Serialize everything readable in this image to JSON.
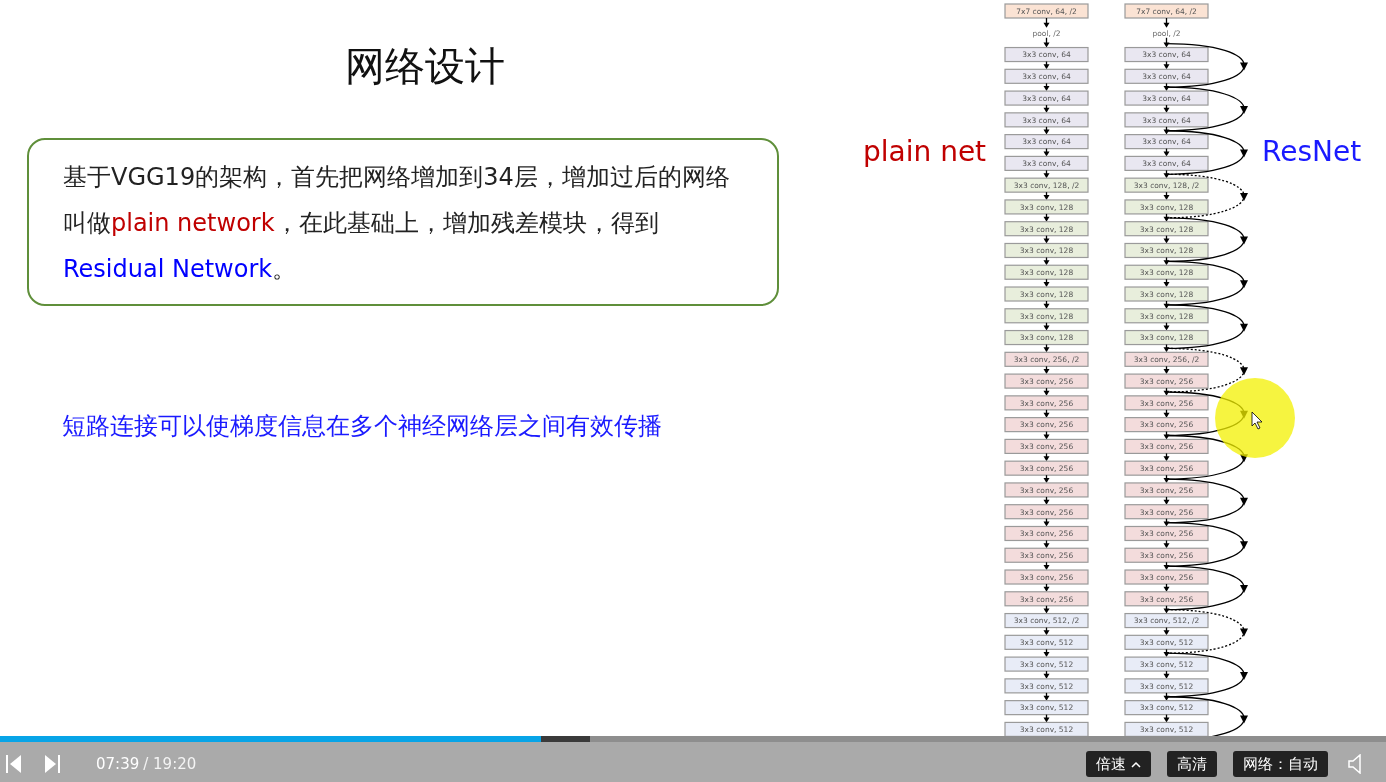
{
  "slide": {
    "title": "网络设计",
    "note_box": [
      {
        "text": "基于VGG19的架构，首先把网络增加到34层，增加过后的网络叫做"
      },
      {
        "text": "plain network",
        "color": "#c00000"
      },
      {
        "text": "，在此基础上，增加残差模块，得到"
      },
      {
        "text": "Residual Network",
        "color": "#0000ff"
      },
      {
        "text": "。"
      }
    ],
    "highlight": "短路连接可以使梯度信息在多个神经网络层之间有效传播",
    "diagram": {
      "plain_label": "plain net",
      "resnet_label": "ResNet",
      "plain": [
        {
          "label": "7x7 conv, 64, /2",
          "kind": "box",
          "color": "#fbe3d4"
        },
        {
          "label": "pool, /2",
          "kind": "text"
        },
        {
          "label": "3x3 conv, 64",
          "kind": "box",
          "color": "#e9e7f1"
        },
        {
          "label": "3x3 conv, 64",
          "kind": "box",
          "color": "#e9e7f1"
        },
        {
          "label": "3x3 conv, 64",
          "kind": "box",
          "color": "#e9e7f1"
        },
        {
          "label": "3x3 conv, 64",
          "kind": "box",
          "color": "#e9e7f1"
        },
        {
          "label": "3x3 conv, 64",
          "kind": "box",
          "color": "#e9e7f1"
        },
        {
          "label": "3x3 conv, 64",
          "kind": "box",
          "color": "#e9e7f1"
        },
        {
          "label": "3x3 conv, 128, /2",
          "kind": "box",
          "color": "#e8eedc"
        },
        {
          "label": "3x3 conv, 128",
          "kind": "box",
          "color": "#e8eedc"
        },
        {
          "label": "3x3 conv, 128",
          "kind": "box",
          "color": "#e8eedc"
        },
        {
          "label": "3x3 conv, 128",
          "kind": "box",
          "color": "#e8eedc"
        },
        {
          "label": "3x3 conv, 128",
          "kind": "box",
          "color": "#e8eedc"
        },
        {
          "label": "3x3 conv, 128",
          "kind": "box",
          "color": "#e8eedc"
        },
        {
          "label": "3x3 conv, 128",
          "kind": "box",
          "color": "#e8eedc"
        },
        {
          "label": "3x3 conv, 128",
          "kind": "box",
          "color": "#e8eedc"
        },
        {
          "label": "3x3 conv, 256, /2",
          "kind": "box",
          "color": "#f3dcdc"
        },
        {
          "label": "3x3 conv, 256",
          "kind": "box",
          "color": "#f3dcdc"
        },
        {
          "label": "3x3 conv, 256",
          "kind": "box",
          "color": "#f3dcdc"
        },
        {
          "label": "3x3 conv, 256",
          "kind": "box",
          "color": "#f3dcdc"
        },
        {
          "label": "3x3 conv, 256",
          "kind": "box",
          "color": "#f3dcdc"
        },
        {
          "label": "3x3 conv, 256",
          "kind": "box",
          "color": "#f3dcdc"
        },
        {
          "label": "3x3 conv, 256",
          "kind": "box",
          "color": "#f3dcdc"
        },
        {
          "label": "3x3 conv, 256",
          "kind": "box",
          "color": "#f3dcdc"
        },
        {
          "label": "3x3 conv, 256",
          "kind": "box",
          "color": "#f3dcdc"
        },
        {
          "label": "3x3 conv, 256",
          "kind": "box",
          "color": "#f3dcdc"
        },
        {
          "label": "3x3 conv, 256",
          "kind": "box",
          "color": "#f3dcdc"
        },
        {
          "label": "3x3 conv, 256",
          "kind": "box",
          "color": "#f3dcdc"
        },
        {
          "label": "3x3 conv, 512, /2",
          "kind": "box",
          "color": "#e8ecf7"
        },
        {
          "label": "3x3 conv, 512",
          "kind": "box",
          "color": "#e8ecf7"
        },
        {
          "label": "3x3 conv, 512",
          "kind": "box",
          "color": "#e8ecf7"
        },
        {
          "label": "3x3 conv, 512",
          "kind": "box",
          "color": "#e8ecf7"
        },
        {
          "label": "3x3 conv, 512",
          "kind": "box",
          "color": "#e8ecf7"
        },
        {
          "label": "3x3 conv, 512",
          "kind": "box",
          "color": "#e8ecf7"
        }
      ],
      "resnet": [
        {
          "label": "7x7 conv, 64, /2",
          "kind": "box",
          "color": "#fbe3d4"
        },
        {
          "label": "pool, /2",
          "kind": "text",
          "shortcut": {
            "dashed": false
          }
        },
        {
          "label": "3x3 conv, 64",
          "kind": "box",
          "color": "#e9e7f1"
        },
        {
          "label": "3x3 conv, 64",
          "kind": "box",
          "color": "#e9e7f1",
          "shortcut": {
            "dashed": false
          }
        },
        {
          "label": "3x3 conv, 64",
          "kind": "box",
          "color": "#e9e7f1"
        },
        {
          "label": "3x3 conv, 64",
          "kind": "box",
          "color": "#e9e7f1",
          "shortcut": {
            "dashed": false
          }
        },
        {
          "label": "3x3 conv, 64",
          "kind": "box",
          "color": "#e9e7f1"
        },
        {
          "label": "3x3 conv, 64",
          "kind": "box",
          "color": "#e9e7f1",
          "shortcut": {
            "dashed": true
          }
        },
        {
          "label": "3x3 conv, 128, /2",
          "kind": "box",
          "color": "#e8eedc"
        },
        {
          "label": "3x3 conv, 128",
          "kind": "box",
          "color": "#e8eedc",
          "shortcut": {
            "dashed": false
          }
        },
        {
          "label": "3x3 conv, 128",
          "kind": "box",
          "color": "#e8eedc"
        },
        {
          "label": "3x3 conv, 128",
          "kind": "box",
          "color": "#e8eedc",
          "shortcut": {
            "dashed": false
          }
        },
        {
          "label": "3x3 conv, 128",
          "kind": "box",
          "color": "#e8eedc"
        },
        {
          "label": "3x3 conv, 128",
          "kind": "box",
          "color": "#e8eedc",
          "shortcut": {
            "dashed": false
          }
        },
        {
          "label": "3x3 conv, 128",
          "kind": "box",
          "color": "#e8eedc"
        },
        {
          "label": "3x3 conv, 128",
          "kind": "box",
          "color": "#e8eedc",
          "shortcut": {
            "dashed": true
          }
        },
        {
          "label": "3x3 conv, 256, /2",
          "kind": "box",
          "color": "#f3dcdc"
        },
        {
          "label": "3x3 conv, 256",
          "kind": "box",
          "color": "#f3dcdc",
          "shortcut": {
            "dashed": false
          }
        },
        {
          "label": "3x3 conv, 256",
          "kind": "box",
          "color": "#f3dcdc"
        },
        {
          "label": "3x3 conv, 256",
          "kind": "box",
          "color": "#f3dcdc",
          "shortcut": {
            "dashed": false
          }
        },
        {
          "label": "3x3 conv, 256",
          "kind": "box",
          "color": "#f3dcdc"
        },
        {
          "label": "3x3 conv, 256",
          "kind": "box",
          "color": "#f3dcdc",
          "shortcut": {
            "dashed": false
          }
        },
        {
          "label": "3x3 conv, 256",
          "kind": "box",
          "color": "#f3dcdc"
        },
        {
          "label": "3x3 conv, 256",
          "kind": "box",
          "color": "#f3dcdc",
          "shortcut": {
            "dashed": false
          }
        },
        {
          "label": "3x3 conv, 256",
          "kind": "box",
          "color": "#f3dcdc"
        },
        {
          "label": "3x3 conv, 256",
          "kind": "box",
          "color": "#f3dcdc",
          "shortcut": {
            "dashed": false
          }
        },
        {
          "label": "3x3 conv, 256",
          "kind": "box",
          "color": "#f3dcdc"
        },
        {
          "label": "3x3 conv, 256",
          "kind": "box",
          "color": "#f3dcdc",
          "shortcut": {
            "dashed": true
          }
        },
        {
          "label": "3x3 conv, 512, /2",
          "kind": "box",
          "color": "#e8ecf7"
        },
        {
          "label": "3x3 conv, 512",
          "kind": "box",
          "color": "#e8ecf7",
          "shortcut": {
            "dashed": false
          }
        },
        {
          "label": "3x3 conv, 512",
          "kind": "box",
          "color": "#e8ecf7"
        },
        {
          "label": "3x3 conv, 512",
          "kind": "box",
          "color": "#e8ecf7",
          "shortcut": {
            "dashed": false
          }
        },
        {
          "label": "3x3 conv, 512",
          "kind": "box",
          "color": "#e8ecf7"
        },
        {
          "label": "3x3 conv, 512",
          "kind": "box",
          "color": "#e8ecf7"
        }
      ]
    }
  },
  "player": {
    "progress": {
      "level": 0.39
    },
    "buffered": {
      "level": 0.426
    },
    "current_time": "07:39",
    "total_time": "/ 19:20",
    "buttons": [
      {
        "label": "倍速",
        "caret": true
      },
      {
        "label": "高清",
        "caret": false
      },
      {
        "label": "网络：自动",
        "caret": false
      }
    ]
  }
}
